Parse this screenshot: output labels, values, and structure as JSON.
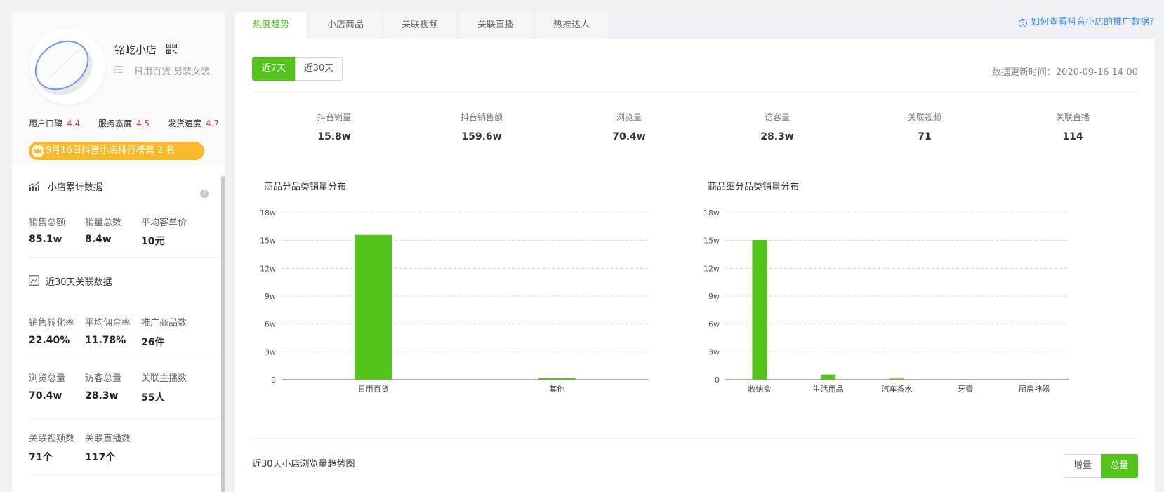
{
  "shop": {
    "name": "铭屹小店",
    "category": "日用百货 男装女装",
    "ratings": [
      {
        "label": "用户口碑",
        "value": "4.4"
      },
      {
        "label": "服务态度",
        "value": "4.5"
      },
      {
        "label": "发货速度",
        "value": "4.7"
      }
    ],
    "rank_badge": "9月16日抖音小店排行榜第 2 名"
  },
  "cumulative": {
    "title": "小店累计数据",
    "stats": [
      {
        "label": "销售总额",
        "value": "85.1w"
      },
      {
        "label": "销量总数",
        "value": "8.4w"
      },
      {
        "label": "平均客单价",
        "value": "10元"
      }
    ]
  },
  "recent30": {
    "title": "近30天关联数据",
    "rows": [
      [
        {
          "label": "销售转化率",
          "value": "22.40%"
        },
        {
          "label": "平均佣金率",
          "value": "11.78%"
        },
        {
          "label": "推广商品数",
          "value": "26件"
        }
      ],
      [
        {
          "label": "浏览总量",
          "value": "70.4w"
        },
        {
          "label": "访客总量",
          "value": "28.3w"
        },
        {
          "label": "关联主播数",
          "value": "55人"
        }
      ],
      [
        {
          "label": "关联视频数",
          "value": "71个"
        },
        {
          "label": "关联直播数",
          "value": "117个"
        }
      ]
    ]
  },
  "tabs": [
    "热度趋势",
    "小店商品",
    "关联视频",
    "关联直播",
    "热推达人"
  ],
  "active_tab": 0,
  "help_link": "如何查看抖音小店的推广数据?",
  "range_buttons": [
    "近7天",
    "近30天"
  ],
  "active_range": 0,
  "update_time": "数据更新时间：2020-09-16 14:00",
  "kpis": [
    {
      "label": "抖音销量",
      "value": "15.8w"
    },
    {
      "label": "抖音销售额",
      "value": "159.6w"
    },
    {
      "label": "浏览量",
      "value": "70.4w"
    },
    {
      "label": "访客量",
      "value": "28.3w"
    },
    {
      "label": "关联视频",
      "value": "71"
    },
    {
      "label": "关联直播",
      "value": "114"
    }
  ],
  "trend_title": "近30天小店浏览量趋势图",
  "toggle_buttons": [
    "增量",
    "总量"
  ],
  "active_toggle": 1,
  "colors": {
    "accent": "#52c41a",
    "rating": "#e8344e",
    "badge": "#f9b928",
    "link": "#3e8be6"
  },
  "chart_data": [
    {
      "type": "bar",
      "title": "商品分品类销量分布",
      "categories": [
        "日用百货",
        "其他"
      ],
      "values": [
        156000,
        1500
      ],
      "ylim": [
        0,
        180000
      ],
      "yticks": [
        "0",
        "3w",
        "6w",
        "9w",
        "12w",
        "15w",
        "18w"
      ],
      "grid": true
    },
    {
      "type": "bar",
      "title": "商品细分品类销量分布",
      "categories": [
        "收纳盒",
        "生活用品",
        "汽车香水",
        "牙膏",
        "厨房神器"
      ],
      "values": [
        150500,
        5500,
        1200,
        0,
        0
      ],
      "ylim": [
        0,
        180000
      ],
      "yticks": [
        "0",
        "3w",
        "6w",
        "9w",
        "12w",
        "15w",
        "18w"
      ],
      "grid": true
    }
  ]
}
